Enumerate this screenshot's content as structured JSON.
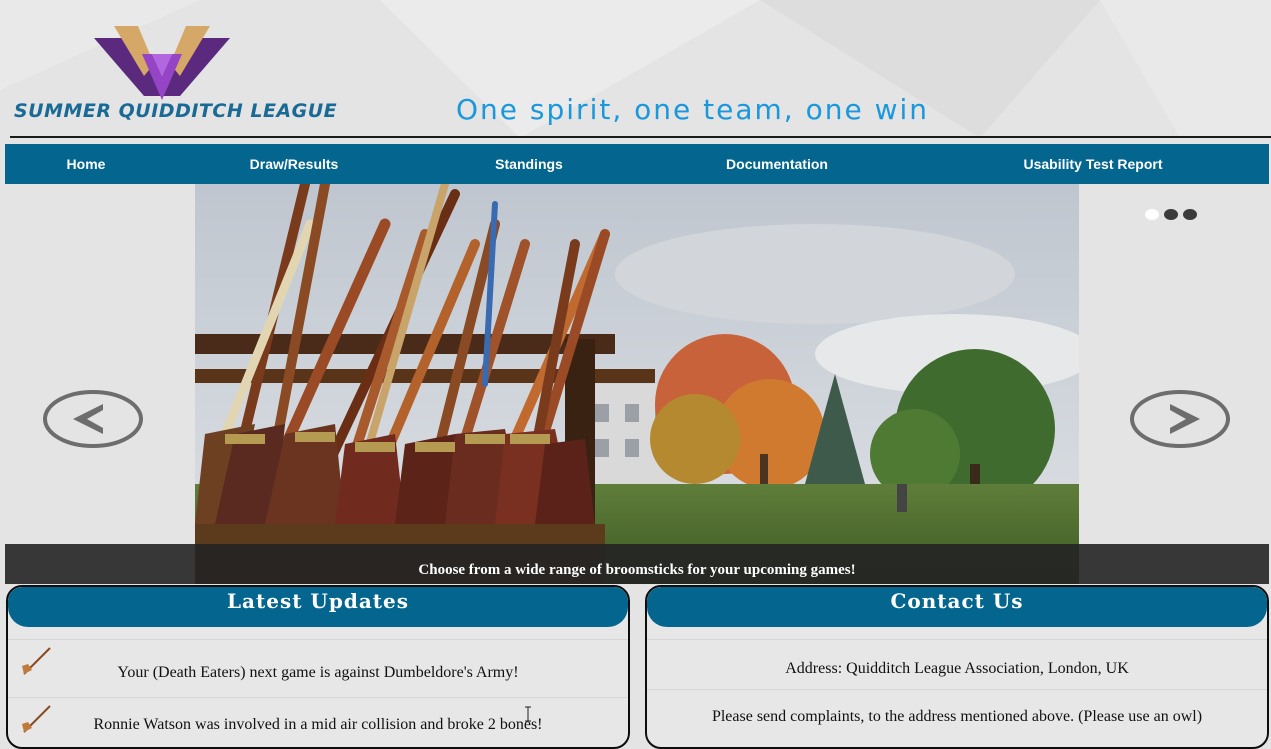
{
  "header": {
    "league_name": "SUMMER QUIDDITCH LEAGUE",
    "tagline": "One spirit, one team, one win",
    "logo_icon": "league-wings-logo"
  },
  "nav": {
    "items": [
      {
        "label": "Home"
      },
      {
        "label": "Draw/Results"
      },
      {
        "label": "Standings"
      },
      {
        "label": "Documentation"
      },
      {
        "label": "Usability Test Report"
      }
    ]
  },
  "slider": {
    "caption": "Choose from a wide range of broomsticks for your upcoming games!",
    "prev_icon": "chevron-left-icon",
    "next_icon": "chevron-right-icon",
    "slide_count": 3,
    "active_slide": 1
  },
  "latest_updates": {
    "title": "Latest Updates",
    "items": [
      {
        "text": "Your (Death Eaters) next game is against Dumbeldore's Army!"
      },
      {
        "text": "Ronnie Watson was involved in a mid air collision and broke 2 bones!"
      }
    ],
    "item_icon": "broomstick-icon"
  },
  "contact": {
    "title": "Contact Us",
    "address": "Address: Quidditch League Association, London, UK",
    "note": "Please send complaints, to the address mentioned above. (Please use an owl)"
  },
  "colors": {
    "nav_bg": "#04668e",
    "tagline": "#1a98dd",
    "league_name": "#1a6a96",
    "page_bg": "#e3e4e3"
  }
}
